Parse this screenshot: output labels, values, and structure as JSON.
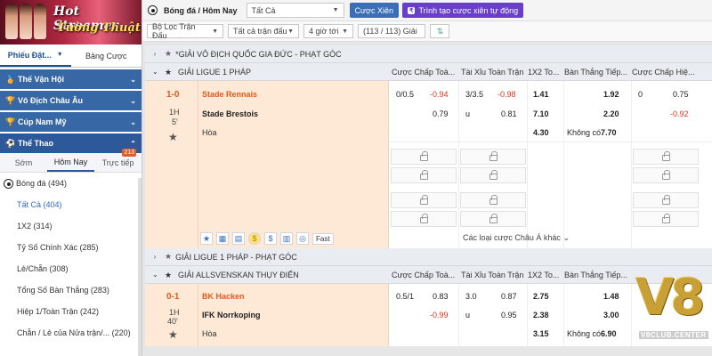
{
  "banner": {
    "line1": "Hot Streamer",
    "line2": "Tường Thuật"
  },
  "sidebar": {
    "tabs": [
      "Phiếu Đặt...",
      "Bảng Cược"
    ],
    "sections": [
      "Thế Vận Hội",
      "Vô Địch Châu Âu",
      "Cúp Nam Mỹ",
      "Thể Thao"
    ],
    "subtabs": [
      "Sớm",
      "Hôm Nay",
      "Trực tiếp"
    ],
    "live_count": "213",
    "items": [
      "Bóng đá (494)",
      "Tất Cả (404)",
      "1X2 (314)",
      "Tỷ Số Chính Xác (285)",
      "Lẻ/Chẵn (308)",
      "Tổng Số Bàn Thắng (283)",
      "Hiệp 1/Toàn Trận (242)",
      "Chẵn / Lẻ của Nửa trận/... (220)"
    ]
  },
  "topbar": {
    "title": "Bóng đá / Hôm Nay",
    "filter_value": "Tất Cả",
    "btn_parlay": "Cược Xiên",
    "btn_auto": "Trình tạo cược xiên tự động",
    "auto_icon": "₹"
  },
  "filterbar": {
    "f1": "Bộ Lọc Trận Đấu",
    "f2": "Tất cả trận đấu",
    "f3": "4 giờ tới",
    "f4": "(113 / 113) Giải"
  },
  "leagues": {
    "l0": "*GIẢI VÔ ĐỊCH QUỐC GIA ĐỨC - PHẠT GÓC",
    "l1": "GIẢI LIGUE 1 PHÁP",
    "l2": "GIẢI LIGUE 1 PHÁP - PHẠT GÓC",
    "l3": "GIẢI ALLSVENSKAN THỤY ĐIỂN"
  },
  "columns": {
    "c1": "Cược Chấp Toà...",
    "c2": "Tài Xỉu Toàn Trận",
    "c3": "1X2 To...",
    "c4": "Bàn Thắng Tiếp...",
    "c5": "Cược Chấp Hiệ..."
  },
  "match1": {
    "score": "1-0",
    "period": "1H",
    "minute": "5'",
    "home": "Stade Rennais",
    "away": "Stade Brestois",
    "draw": "Hòa",
    "hc_line": "0/0.5",
    "hc_home": "-0.94",
    "hc_away": "0.79",
    "ou_line": "3/3.5",
    "ou_over": "-0.98",
    "ou_u": "u",
    "ou_under": "0.81",
    "x_home": "1.41",
    "x_away": "7.10",
    "x_draw": "4.30",
    "ng_home": "1.92",
    "ng_away": "2.20",
    "ng_none_label": "Không có",
    "ng_none": "7.70",
    "hh_line": "0",
    "hh_home": "0.75",
    "hh_away": "-0.92",
    "fast": "Fast",
    "more": "Các loại cược Châu Á khác"
  },
  "match2": {
    "score": "0-1",
    "period": "1H",
    "minute": "40'",
    "home": "BK Hacken",
    "away": "IFK Norrkoping",
    "draw": "Hòa",
    "hc_line": "0.5/1",
    "hc_home": "0.83",
    "hc_away": "-0.99",
    "ou_line": "3.0",
    "ou_over": "0.87",
    "ou_u": "u",
    "ou_under": "0.95",
    "x_home": "2.75",
    "x_away": "2.38",
    "x_draw": "3.15",
    "ng_home": "1.48",
    "ng_away": "3.00",
    "ng_none_label": "Không có",
    "ng_none": "6.90"
  },
  "watermark": {
    "logo": "V8",
    "url": "V8CLUB.CENTER"
  },
  "colors": {
    "sidebar_header": "#3867a6",
    "accent_orange": "#e05a1e",
    "negative_red": "#e0351b",
    "team_bg": "#fde9d6"
  }
}
